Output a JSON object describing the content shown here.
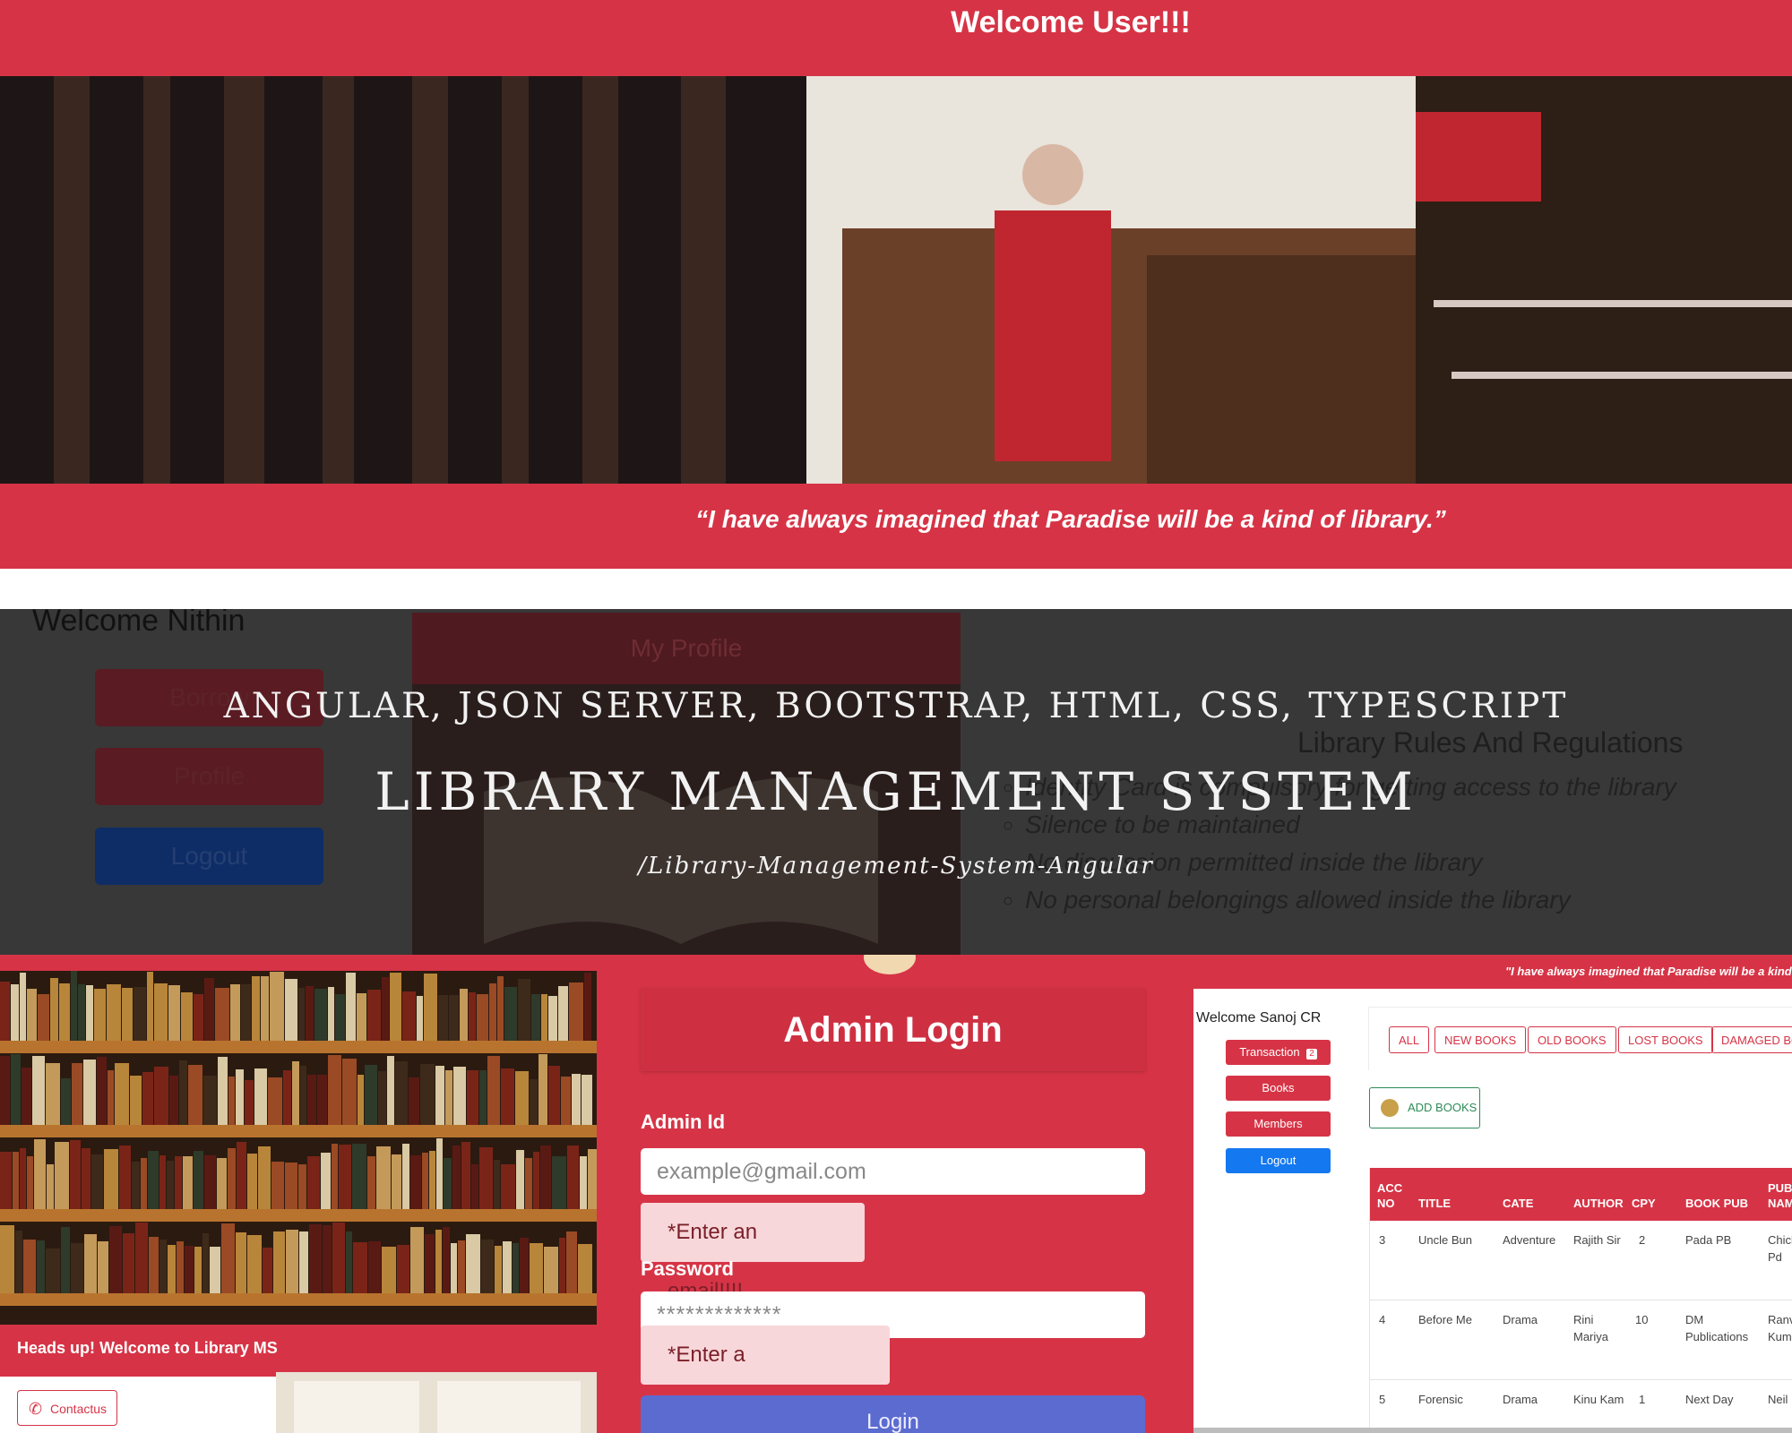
{
  "top": {
    "welcome": "Welcome User!!!",
    "quote": "“I have always imagined that Paradise will be a kind of library.”"
  },
  "middle": {
    "welcome_user": "Welcome Nithin",
    "buttons": {
      "borrow": "Borrow",
      "profile": "Profile",
      "logout": "Logout"
    },
    "my_profile": "My Profile",
    "rules_title": "Library Rules And Regulations",
    "rules": [
      "Identity Card is compulsory for getting access to the library",
      "Silence to be maintained",
      "No discussion permitted inside the library",
      "No personal belongings allowed inside the library"
    ],
    "tech_stack": "ANGULAR, JSON SERVER, BOOTSTRAP, HTML, CSS, TYPESCRIPT",
    "project_title": "LIBRARY MANAGEMENT SYSTEM",
    "repo_path": "/Library-Management-System-Angular"
  },
  "left_panel": {
    "heads_up": "Heads up! Welcome to Library MS",
    "contact_button": "Contactus"
  },
  "admin_login": {
    "title": "Admin Login",
    "admin_id_label": "Admin Id",
    "email_placeholder": "example@gmail.com",
    "email_error": "*Enter an email!!!!.",
    "password_label": "Password",
    "password_value": "*************",
    "password_error": "*Enter a password!!!!.",
    "login_button": "Login"
  },
  "dashboard": {
    "quote": "\"I have always imagined that Paradise will be a kind of",
    "welcome": "Welcome Sanoj CR",
    "sidebar": {
      "transaction": "Transaction",
      "transaction_badge": "2",
      "books": "Books",
      "members": "Members",
      "logout": "Logout"
    },
    "filters": [
      "ALL",
      "NEW BOOKS",
      "OLD BOOKS",
      "LOST BOOKS",
      "DAMAGED BO"
    ],
    "add_books": "ADD BOOKS",
    "columns": [
      "ACC NO",
      "TITLE",
      "CATE",
      "AUTHOR",
      "CPY",
      "BOOK PUB",
      "PUB NAM"
    ],
    "rows": [
      [
        "3",
        "Uncle Bun",
        "Adventure",
        "Rajith Sir",
        "2",
        "Pada PB",
        "Chick Pd"
      ],
      [
        "4",
        "Before Me",
        "Drama",
        "Rini Mariya",
        "10",
        "DM Publications",
        "Ranv Kum"
      ],
      [
        "5",
        "Forensic",
        "Drama",
        "Kinu Kam",
        "1",
        "Next Day",
        "Neil"
      ]
    ]
  },
  "colors": {
    "brand_red": "#d63446",
    "primary_blue": "#1478f0",
    "alert_pink": "#f8d7da"
  }
}
